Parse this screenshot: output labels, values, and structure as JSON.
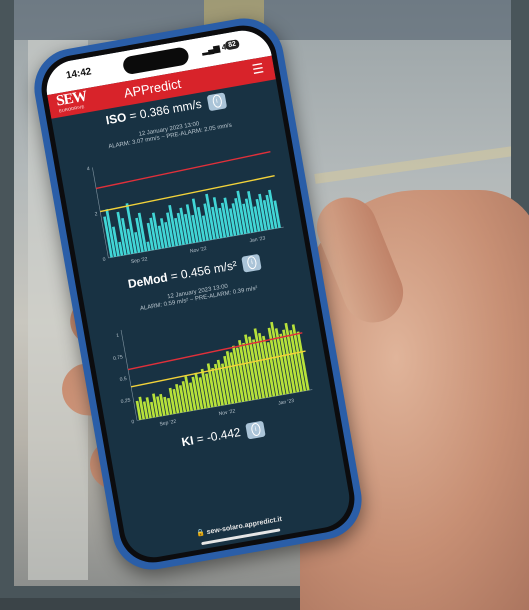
{
  "statusbar": {
    "time": "14:42",
    "signal": "4G",
    "battery": "82"
  },
  "app": {
    "logo_text": "SEW",
    "logo_sub": "EURODRIVE",
    "title": "APPredict",
    "menu_icon": "hamburger-icon"
  },
  "metrics": [
    {
      "label": "ISO",
      "value_text": " = 0.386 mm/s",
      "date": "12 January 2023 13:00",
      "alarm": "ALARM: 3.07 mm/s ~ PRE-ALARM: 2.05 mm/s",
      "color": "#41d6d6"
    },
    {
      "label": "DeMod",
      "value_text": " = 0.456 m/s²",
      "date": "12 January 2023 13:00",
      "alarm": "ALARM: 0.59 m/s² ~ PRE-ALARM: 0.39 m/s²",
      "color": "#b7e23a"
    },
    {
      "label": "KI",
      "value_text": " = -0.442"
    }
  ],
  "url": "sew-solaro.appredict.it",
  "chart_data": [
    {
      "type": "bar",
      "x": [
        "Sep '22",
        "Nov '22",
        "Jan '23"
      ],
      "y_ticks": [
        "0",
        "2",
        "4"
      ],
      "ylim": [
        0,
        4
      ],
      "alarm": 3.07,
      "pre_alarm": 2.05,
      "values": [
        1.8,
        2.1,
        1.3,
        0.6,
        1.9,
        1.6,
        1.1,
        2.2,
        0.9,
        1.5,
        1.7,
        0.4,
        1.2,
        1.4,
        1.6,
        1.0,
        1.3,
        1.1,
        1.5,
        1.8,
        1.2,
        1.4,
        1.6,
        1.3,
        1.7,
        1.2,
        1.9,
        1.5,
        1.1,
        1.6,
        2.0,
        1.4,
        1.8,
        1.3,
        1.5,
        1.7,
        1.2,
        1.4,
        1.6,
        1.9,
        1.3,
        1.5,
        1.8,
        1.1,
        1.4,
        1.6,
        1.3,
        1.5,
        1.7,
        1.2
      ]
    },
    {
      "type": "bar",
      "x": [
        "Sep '22",
        "Nov '22",
        "Jan '23"
      ],
      "y_ticks": [
        "0",
        "0.25",
        "0.5",
        "0.75",
        "1"
      ],
      "ylim": [
        0,
        1.05
      ],
      "alarm": 0.59,
      "pre_alarm": 0.39,
      "values": [
        0.22,
        0.26,
        0.2,
        0.24,
        0.18,
        0.27,
        0.23,
        0.25,
        0.21,
        0.19,
        0.3,
        0.28,
        0.33,
        0.31,
        0.35,
        0.4,
        0.32,
        0.38,
        0.42,
        0.36,
        0.45,
        0.39,
        0.5,
        0.44,
        0.48,
        0.52,
        0.47,
        0.55,
        0.6,
        0.58,
        0.65,
        0.62,
        0.7,
        0.66,
        0.75,
        0.72,
        0.68,
        0.8,
        0.74,
        0.7,
        0.62,
        0.78,
        0.84,
        0.76,
        0.69,
        0.73,
        0.8,
        0.71,
        0.77,
        0.68
      ]
    }
  ]
}
